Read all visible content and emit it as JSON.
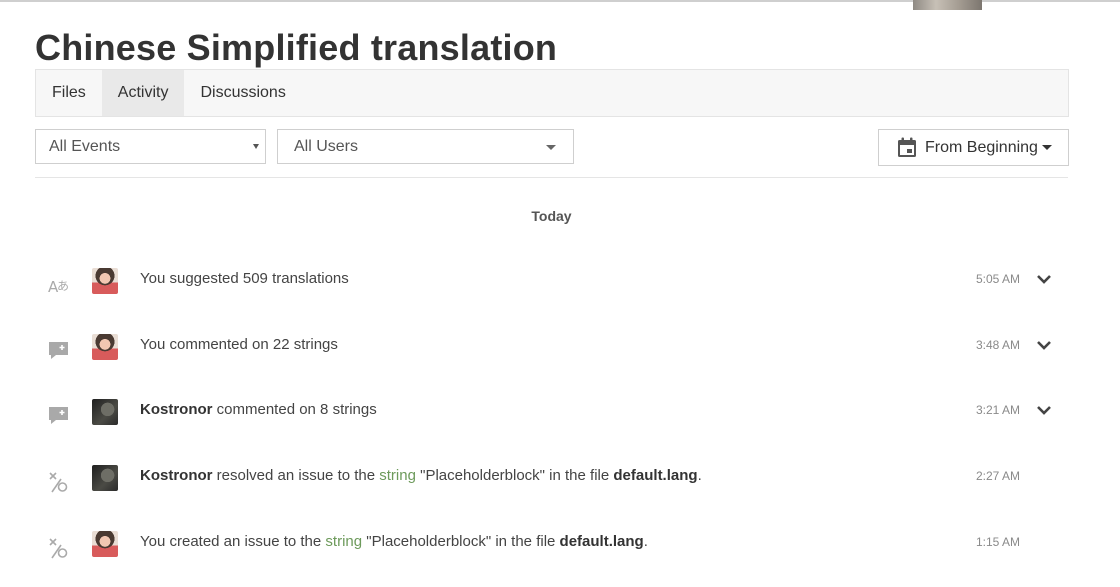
{
  "header": {
    "title": "Chinese Simplified translation"
  },
  "tabs": [
    {
      "label": "Files",
      "active": false
    },
    {
      "label": "Activity",
      "active": true
    },
    {
      "label": "Discussions",
      "active": false
    }
  ],
  "filters": {
    "events": {
      "selected": "All Events"
    },
    "users": {
      "selected": "All Users"
    },
    "date": {
      "label": "From Beginning",
      "icon": "calendar-icon"
    }
  },
  "day_header": "Today",
  "activity": [
    {
      "icon": "translate-icon",
      "avatar": "avatar-girl",
      "user": "",
      "text_before": "You suggested 509 translations",
      "link": "",
      "text_middle": "",
      "file": "",
      "text_after": "",
      "time": "5:05 AM",
      "expandable": true
    },
    {
      "icon": "comment-icon",
      "avatar": "avatar-girl",
      "user": "",
      "text_before": "You commented on 22 strings",
      "link": "",
      "text_middle": "",
      "file": "",
      "text_after": "",
      "time": "3:48 AM",
      "expandable": true
    },
    {
      "icon": "comment-icon",
      "avatar": "avatar-dark",
      "user": "Kostronor",
      "text_before": " commented on 8 strings",
      "link": "",
      "text_middle": "",
      "file": "",
      "text_after": "",
      "time": "3:21 AM",
      "expandable": true
    },
    {
      "icon": "issue-icon",
      "avatar": "avatar-dark",
      "user": "Kostronor",
      "text_before": " resolved an issue to the ",
      "link": "string",
      "text_middle": " \"Placeholderblock\" in the file ",
      "file": "default.lang",
      "text_after": ".",
      "time": "2:27 AM",
      "expandable": false
    },
    {
      "icon": "issue-icon",
      "avatar": "avatar-girl",
      "user": "",
      "text_before": "You created an issue to the ",
      "link": "string",
      "text_middle": " \"Placeholderblock\" in the file ",
      "file": "default.lang",
      "text_after": ".",
      "time": "1:15 AM",
      "expandable": false
    }
  ]
}
